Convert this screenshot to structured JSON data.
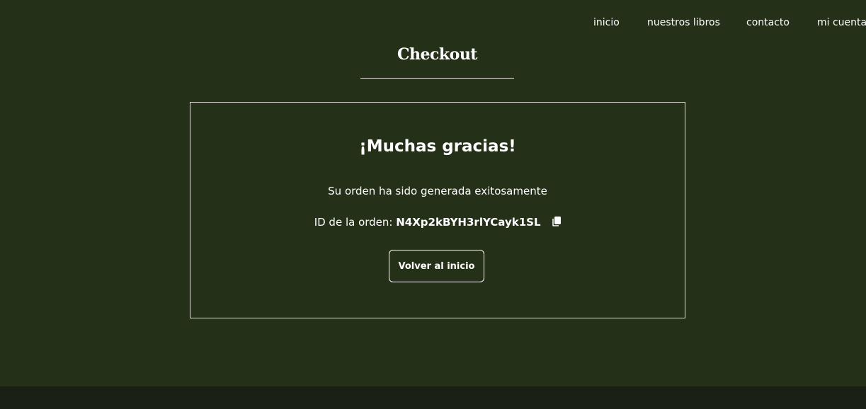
{
  "nav": {
    "items": [
      {
        "label": "inicio"
      },
      {
        "label": "nuestros libros"
      },
      {
        "label": "contacto"
      },
      {
        "label": "mi cuenta"
      }
    ]
  },
  "page": {
    "title": "Checkout"
  },
  "confirmation": {
    "heading": "¡Muchas gracias!",
    "message": "Su orden ha sido generada exitosamente",
    "order_label": "ID de la orden:",
    "order_id": "N4Xp2kBYH3rlYCayk1SL",
    "copy_icon": "copy-icon",
    "back_button_label": "Volver al inicio"
  },
  "colors": {
    "background": "#253018",
    "footer": "#1a2013",
    "text": "#ffffff"
  }
}
